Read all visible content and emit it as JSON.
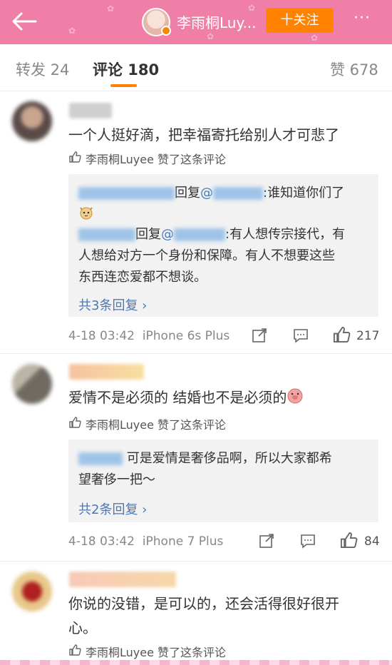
{
  "header": {
    "user_name": "李雨桐Luy...",
    "follow_label": "十关注",
    "more_label": "···"
  },
  "tabs": {
    "repost": "转发 24",
    "comment": "评论 180",
    "like": "赞 678"
  },
  "comments": [
    {
      "text": "一个人挺好滴，把幸福寄托给别人才可悲了",
      "liked_by": "李雨桐Luyee 赞了这条评论",
      "replies": [
        {
          "prefix": "回复",
          "at": "@",
          "rest": ":谁知道你们了"
        },
        {
          "prefix": "回复",
          "at": "@",
          "rest": ":有人想传宗接代，有"
        },
        {
          "line": "人想给对方一个身份和保障。有人不想要这些"
        },
        {
          "line": "东西连恋爱都不想谈。"
        }
      ],
      "more_replies": "共3条回复 ›",
      "timestamp": "4-18 03:42",
      "device": "iPhone 6s Plus",
      "like_count": "217"
    },
    {
      "text": "爱情不是必须的 结婚也不是必须的",
      "liked_by": "李雨桐Luyee 赞了这条评论",
      "replies": [
        {
          "rest": "可是爱情是奢侈品啊，所以大家都希"
        },
        {
          "line": "望奢侈一把～"
        }
      ],
      "more_replies": "共2条回复 ›",
      "timestamp": "4-18 03:42",
      "device": "iPhone 7 Plus",
      "like_count": "84"
    },
    {
      "text_line1": "你说的没错，是可以的，还会活得很好很开",
      "text_line2": "心。",
      "liked_by": "李雨桐Luyee 赞了这条评论"
    }
  ],
  "colors": {
    "header_bg": "#f07fa8",
    "follow_bg": "#ff8200",
    "link": "#4a78b4",
    "tab_active_underline": "#ff8200"
  }
}
